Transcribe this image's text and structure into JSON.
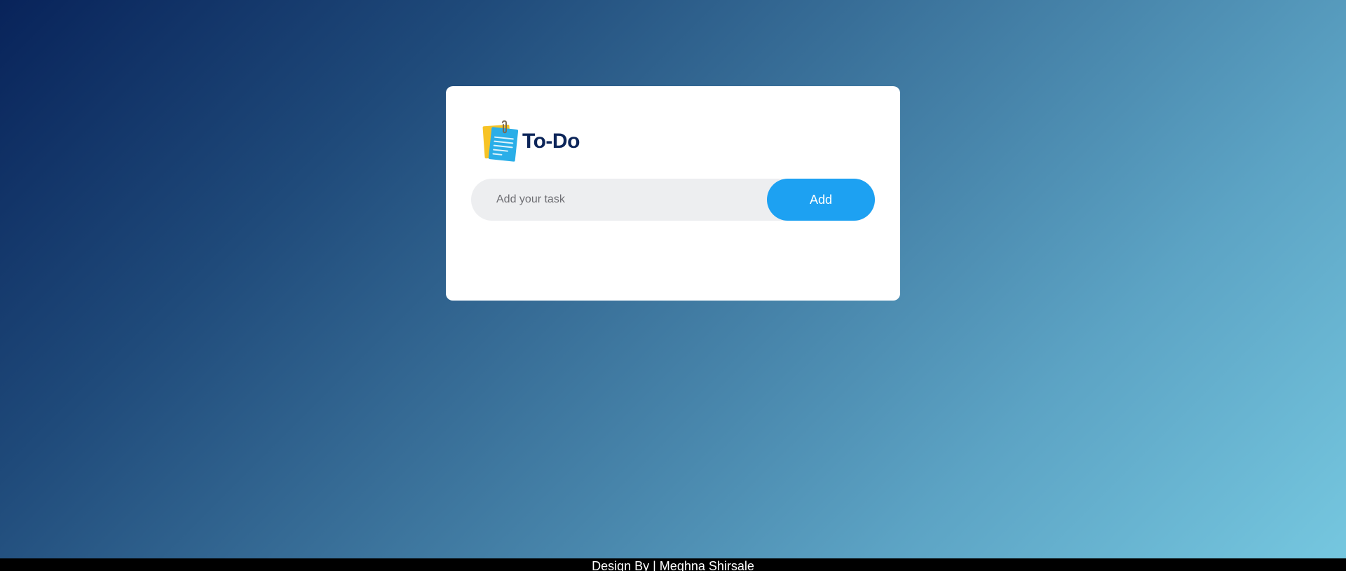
{
  "app": {
    "title": "To-Do",
    "logo_icon": "sticky-notes-icon"
  },
  "input": {
    "value": "",
    "placeholder": "Add your task"
  },
  "add_button": {
    "label": "Add"
  },
  "tasks": [],
  "footer": {
    "credit": "Design By | Meghna Shirsale"
  },
  "colors": {
    "gradient": [
      "#08235a",
      "#1f4a7a",
      "#3e779f",
      "#5ca3c4",
      "#76c8e0"
    ],
    "title": "#0c2559",
    "input_bg": "#edeef0",
    "accent": "#1da1f2",
    "footer_bg": "#000000"
  }
}
